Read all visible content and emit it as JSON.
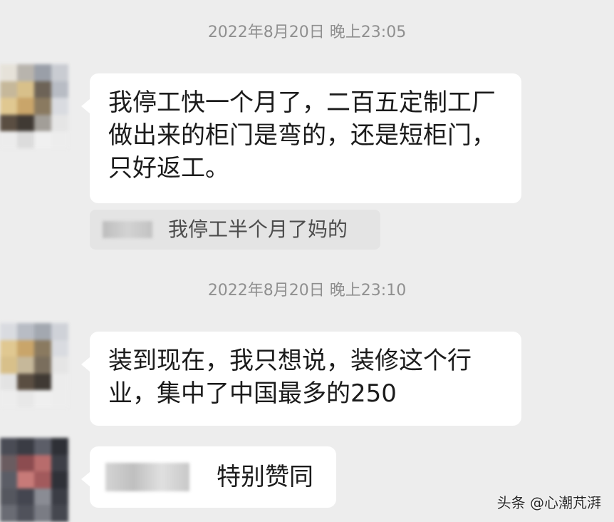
{
  "chat": {
    "timestamp_1": "2022年8月20日 晚上23:05",
    "message_1": "我停工快一个月了，二百五定制工厂做出来的柜门是弯的，还是短柜门，只好返工。",
    "reply_1": "我停工半个月了妈的",
    "timestamp_2": "2022年8月20日 晚上23:10",
    "message_2": "装到现在，我只想说，装修这个行业，集中了中国最多的250",
    "reply_2": "特别赞同"
  },
  "watermark": "头条 @心潮芃湃",
  "colors": {
    "background": "#ededed",
    "bubble": "#ffffff",
    "quote": "#e4e4e4",
    "timestamp_text": "#8f8f8f"
  }
}
